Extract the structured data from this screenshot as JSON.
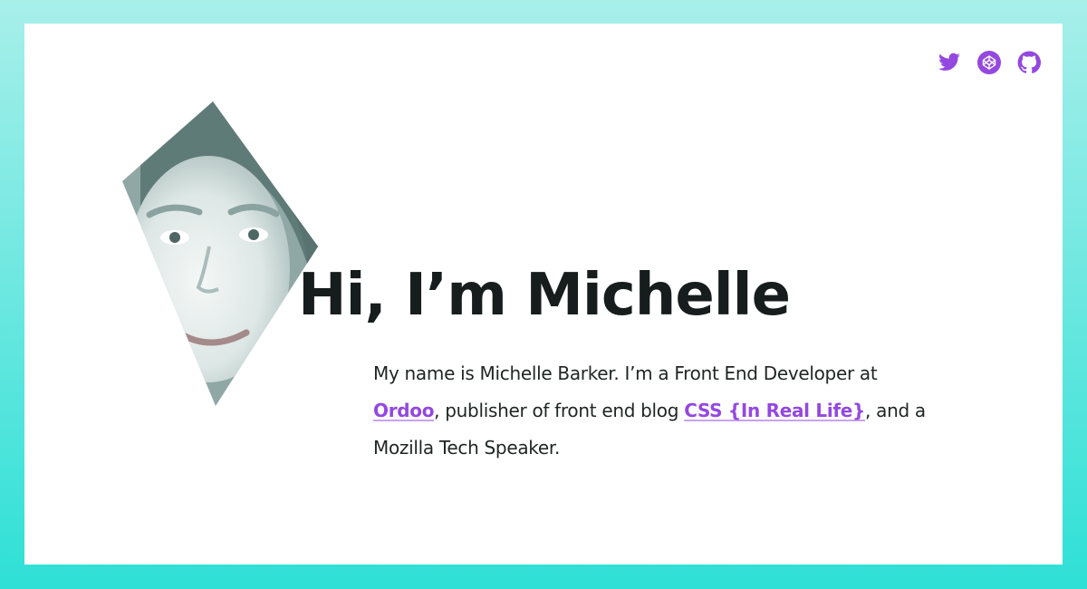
{
  "social": {
    "accent_color": "#9448e0",
    "links": [
      {
        "icon": "twitter-icon",
        "label": "Twitter"
      },
      {
        "icon": "codepen-icon",
        "label": "CodePen"
      },
      {
        "icon": "github-icon",
        "label": "GitHub"
      }
    ]
  },
  "hero": {
    "heading": "Hi, I’m Michelle",
    "portrait_alt": "Michelle Barker",
    "bio": {
      "text_1": "My name is Michelle Barker. I’m a Front End Developer at ",
      "link_1": "Ordoo",
      "text_2": ", publisher of front end blog ",
      "link_2": "CSS {In Real Life}",
      "text_3": ", and a Mozilla Tech Speaker."
    }
  },
  "colors": {
    "frame_gradient_top": "#a8efea",
    "frame_gradient_bottom": "#2ee0d6",
    "heading": "#171d1c",
    "link": "#9448e0"
  }
}
